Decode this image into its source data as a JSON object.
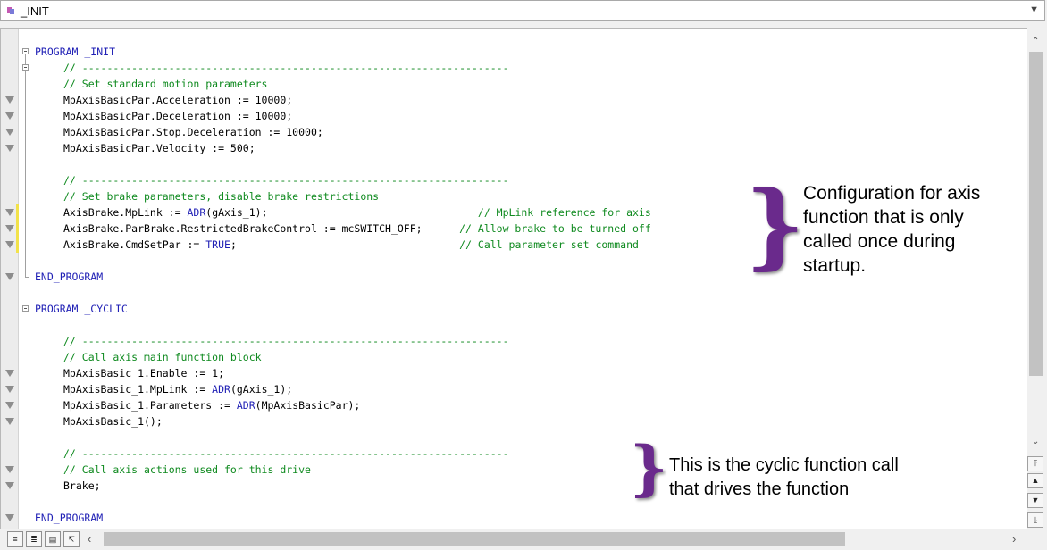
{
  "header": {
    "title": "_INIT",
    "file_icon": "program-file-icon",
    "dropdown_icon": "chevron-down-icon"
  },
  "code_lines": [
    {
      "indent": 0,
      "parts": [
        {
          "t": "PROGRAM _INIT",
          "c": "kw"
        }
      ]
    },
    {
      "indent": 1,
      "parts": [
        {
          "t": "// ---------------------------------------------------------------------",
          "c": "cm"
        }
      ]
    },
    {
      "indent": 1,
      "parts": [
        {
          "t": "// Set standard motion parameters",
          "c": "cm"
        }
      ]
    },
    {
      "indent": 1,
      "parts": [
        {
          "t": "MpAxisBasicPar.Acceleration := 10000;",
          "c": ""
        }
      ]
    },
    {
      "indent": 1,
      "parts": [
        {
          "t": "MpAxisBasicPar.Deceleration := 10000;",
          "c": ""
        }
      ]
    },
    {
      "indent": 1,
      "parts": [
        {
          "t": "MpAxisBasicPar.Stop.Deceleration := 10000;",
          "c": ""
        }
      ]
    },
    {
      "indent": 1,
      "parts": [
        {
          "t": "MpAxisBasicPar.Velocity := 500;",
          "c": ""
        }
      ]
    },
    {
      "indent": 0,
      "parts": []
    },
    {
      "indent": 1,
      "parts": [
        {
          "t": "// ---------------------------------------------------------------------",
          "c": "cm"
        }
      ]
    },
    {
      "indent": 1,
      "parts": [
        {
          "t": "// Set brake parameters, disable brake restrictions",
          "c": "cm"
        }
      ]
    },
    {
      "indent": 1,
      "parts": [
        {
          "t": "AxisBrake.MpLink := ",
          "c": ""
        },
        {
          "t": "ADR",
          "c": "kw"
        },
        {
          "t": "(gAxis_1);                                  ",
          "c": ""
        },
        {
          "t": "// MpLink reference for axis",
          "c": "cm"
        }
      ]
    },
    {
      "indent": 1,
      "parts": [
        {
          "t": "AxisBrake.ParBrake.RestrictedBrakeControl := mcSWITCH_OFF;      ",
          "c": ""
        },
        {
          "t": "// Allow brake to be turned off",
          "c": "cm"
        }
      ]
    },
    {
      "indent": 1,
      "parts": [
        {
          "t": "AxisBrake.CmdSetPar := ",
          "c": ""
        },
        {
          "t": "TRUE",
          "c": "kw"
        },
        {
          "t": ";                                    ",
          "c": ""
        },
        {
          "t": "// Call parameter set command",
          "c": "cm"
        }
      ]
    },
    {
      "indent": 0,
      "parts": []
    },
    {
      "indent": 0,
      "parts": [
        {
          "t": "END_PROGRAM",
          "c": "kw"
        }
      ]
    },
    {
      "indent": 0,
      "parts": []
    },
    {
      "indent": 0,
      "parts": [
        {
          "t": "PROGRAM _CYCLIC",
          "c": "kw"
        }
      ]
    },
    {
      "indent": 0,
      "parts": []
    },
    {
      "indent": 1,
      "parts": [
        {
          "t": "// ---------------------------------------------------------------------",
          "c": "cm"
        }
      ]
    },
    {
      "indent": 1,
      "parts": [
        {
          "t": "// Call axis main function block",
          "c": "cm"
        }
      ]
    },
    {
      "indent": 1,
      "parts": [
        {
          "t": "MpAxisBasic_1.Enable := 1;",
          "c": ""
        }
      ]
    },
    {
      "indent": 1,
      "parts": [
        {
          "t": "MpAxisBasic_1.MpLink := ",
          "c": ""
        },
        {
          "t": "ADR",
          "c": "kw"
        },
        {
          "t": "(gAxis_1);",
          "c": ""
        }
      ]
    },
    {
      "indent": 1,
      "parts": [
        {
          "t": "MpAxisBasic_1.Parameters := ",
          "c": ""
        },
        {
          "t": "ADR",
          "c": "kw"
        },
        {
          "t": "(MpAxisBasicPar);",
          "c": ""
        }
      ]
    },
    {
      "indent": 1,
      "parts": [
        {
          "t": "MpAxisBasic_1();",
          "c": ""
        }
      ]
    },
    {
      "indent": 0,
      "parts": []
    },
    {
      "indent": 1,
      "parts": [
        {
          "t": "// ---------------------------------------------------------------------",
          "c": "cm"
        }
      ]
    },
    {
      "indent": 1,
      "parts": [
        {
          "t": "// Call axis actions used for this drive",
          "c": "cm"
        }
      ]
    },
    {
      "indent": 1,
      "parts": [
        {
          "t": "Brake;",
          "c": ""
        }
      ]
    },
    {
      "indent": 0,
      "parts": []
    },
    {
      "indent": 0,
      "parts": [
        {
          "t": "END_PROGRAM",
          "c": "kw"
        }
      ]
    }
  ],
  "annotations": {
    "init_note": "Configuration for axis\nfunction that is only\ncalled once during\nstartup.",
    "cyclic_note": "This is the cyclic function call\nthat drives the function",
    "brace_glyph": "}",
    "brace_color": "#6a2a8c"
  },
  "colors": {
    "keyword": "#1f1fb5",
    "comment": "#0f8a1f",
    "modified_marker": "#f2e24a"
  },
  "bottom_toolbar": [
    "text-view-icon",
    "outline-view-icon",
    "table-view-icon",
    "declaration-view-icon"
  ]
}
